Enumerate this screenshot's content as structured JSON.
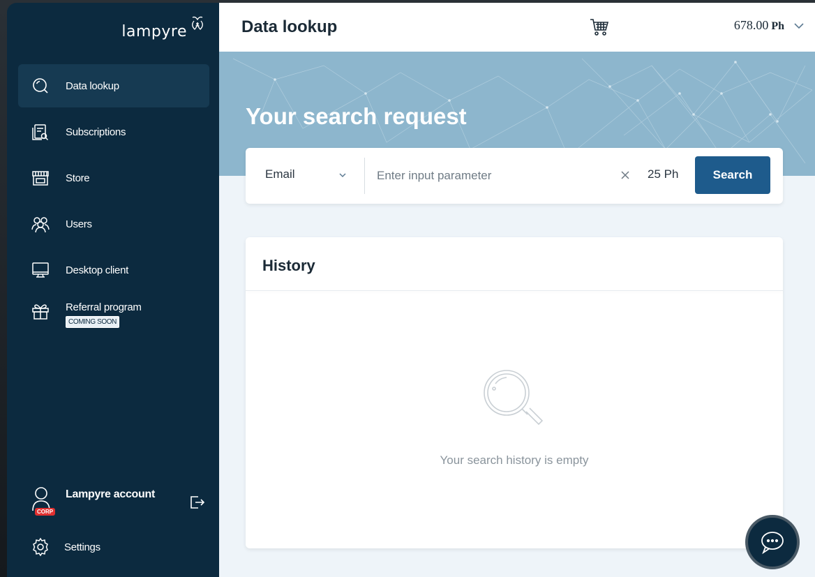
{
  "brand": {
    "name": "lampyre"
  },
  "sidebar": {
    "items": [
      {
        "label": "Data lookup",
        "icon": "search-icon",
        "active": true
      },
      {
        "label": "Subscriptions",
        "icon": "subscriptions-icon"
      },
      {
        "label": "Store",
        "icon": "store-icon"
      },
      {
        "label": "Users",
        "icon": "users-icon"
      },
      {
        "label": "Desktop client",
        "icon": "monitor-icon"
      },
      {
        "label": "Referral program",
        "icon": "gift-icon",
        "badge": "COMING SOON"
      }
    ],
    "account": {
      "name": "Lampyre account",
      "badge": "CORP"
    },
    "settings": {
      "label": "Settings"
    }
  },
  "header": {
    "title": "Data lookup",
    "balance": "678.00",
    "balance_unit": "Ph"
  },
  "hero": {
    "title": "Your search request"
  },
  "search": {
    "type": "Email",
    "placeholder": "Enter input parameter",
    "cost": "25 Ph",
    "button": "Search"
  },
  "history": {
    "title": "History",
    "empty_text": "Your search history is empty"
  },
  "colors": {
    "sidebar_bg": "#0c2a3f",
    "accent": "#1e5b8c",
    "hero_bg": "#8db6cd",
    "badge_red": "#e03030"
  }
}
